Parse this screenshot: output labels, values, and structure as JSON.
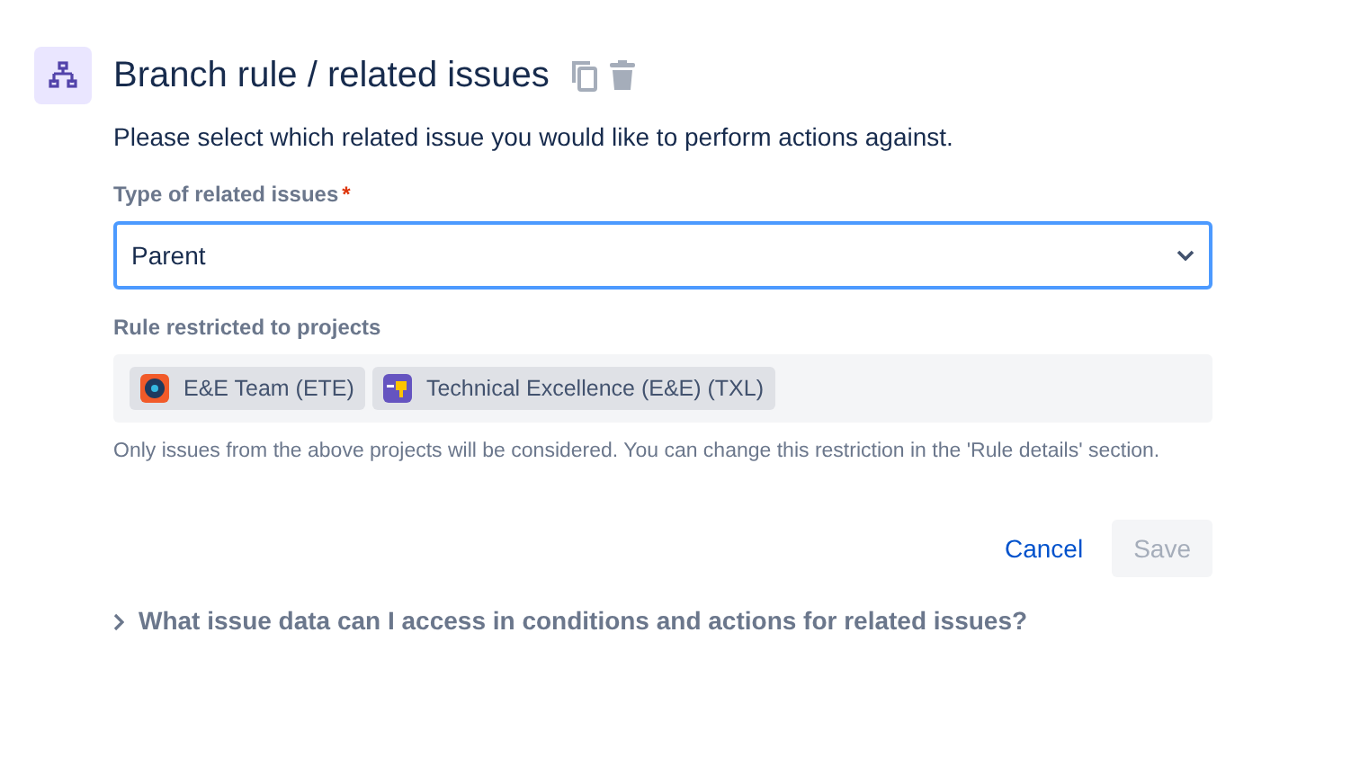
{
  "header": {
    "title": "Branch rule / related issues"
  },
  "description": "Please select which related issue you would like to perform actions against.",
  "type_field": {
    "label": "Type of related issues",
    "required_mark": "*",
    "value": "Parent"
  },
  "projects": {
    "label": "Rule restricted to projects",
    "items": [
      {
        "name": "E&E Team (ETE)"
      },
      {
        "name": "Technical Excellence (E&E) (TXL)"
      }
    ],
    "help": "Only issues from the above projects will be considered. You can change this restriction in the 'Rule details' section."
  },
  "buttons": [
    {
      "label": "Cancel",
      "kind": "link",
      "disabled": false
    },
    {
      "label": "Save",
      "kind": "primary",
      "disabled": true
    }
  ],
  "expander": {
    "label": "What issue data can I access in conditions and actions for related issues?",
    "expanded": false
  }
}
